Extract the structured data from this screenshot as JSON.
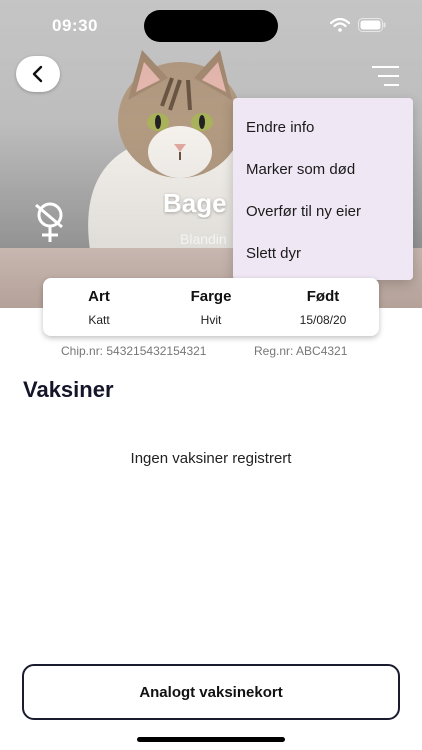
{
  "status_bar": {
    "time": "09:30"
  },
  "pet": {
    "name": "Bage",
    "breed": "Blandin"
  },
  "menu": {
    "items": [
      {
        "label": "Endre info"
      },
      {
        "label": "Marker som død"
      },
      {
        "label": "Overfør til ny eier"
      },
      {
        "label": "Slett dyr"
      }
    ]
  },
  "info": {
    "columns": [
      {
        "label": "Art",
        "value": "Katt"
      },
      {
        "label": "Farge",
        "value": "Hvit"
      },
      {
        "label": "Født",
        "value": "15/08/20"
      }
    ],
    "chip": "Chip.nr: 543215432154321",
    "reg": "Reg.nr: ABC4321"
  },
  "vaccines": {
    "title": "Vaksiner",
    "empty": "Ingen vaksiner registrert",
    "button_label": "Analogt vaksinekort"
  },
  "colors": {
    "menu_bg": "#efe7f4",
    "title": "#151529"
  }
}
